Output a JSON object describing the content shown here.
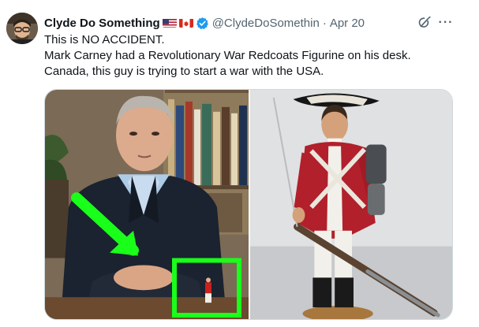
{
  "author": {
    "display_name": "Clyde Do Something",
    "flags": [
      "us-flag-icon",
      "canada-flag-icon"
    ],
    "verified_icon": "verified-badge-icon",
    "handle": "@ClydeDoSomethin",
    "separator": "·",
    "date": "Apr 20",
    "avatar_icon": "avatar"
  },
  "actions": {
    "grok_icon": "grok-icon",
    "more_label": "···"
  },
  "tweet_text": {
    "line1": "This is NO ACCIDENT.",
    "line2": "Mark Carney had a Revolutionary War Redcoats Figurine on his desk.",
    "line3": "Canada, this guy is trying to start a war with the USA."
  },
  "media": {
    "left_image": "photo of man in suit at desk with green arrow and box highlighting a small red figurine",
    "right_image": "photo of revolutionary war redcoat soldier figurine with musket"
  },
  "colors": {
    "verified": "#1d9bf0",
    "highlight_green": "#1aff1a",
    "secondary_text": "#536471",
    "border": "#cfd9de"
  }
}
